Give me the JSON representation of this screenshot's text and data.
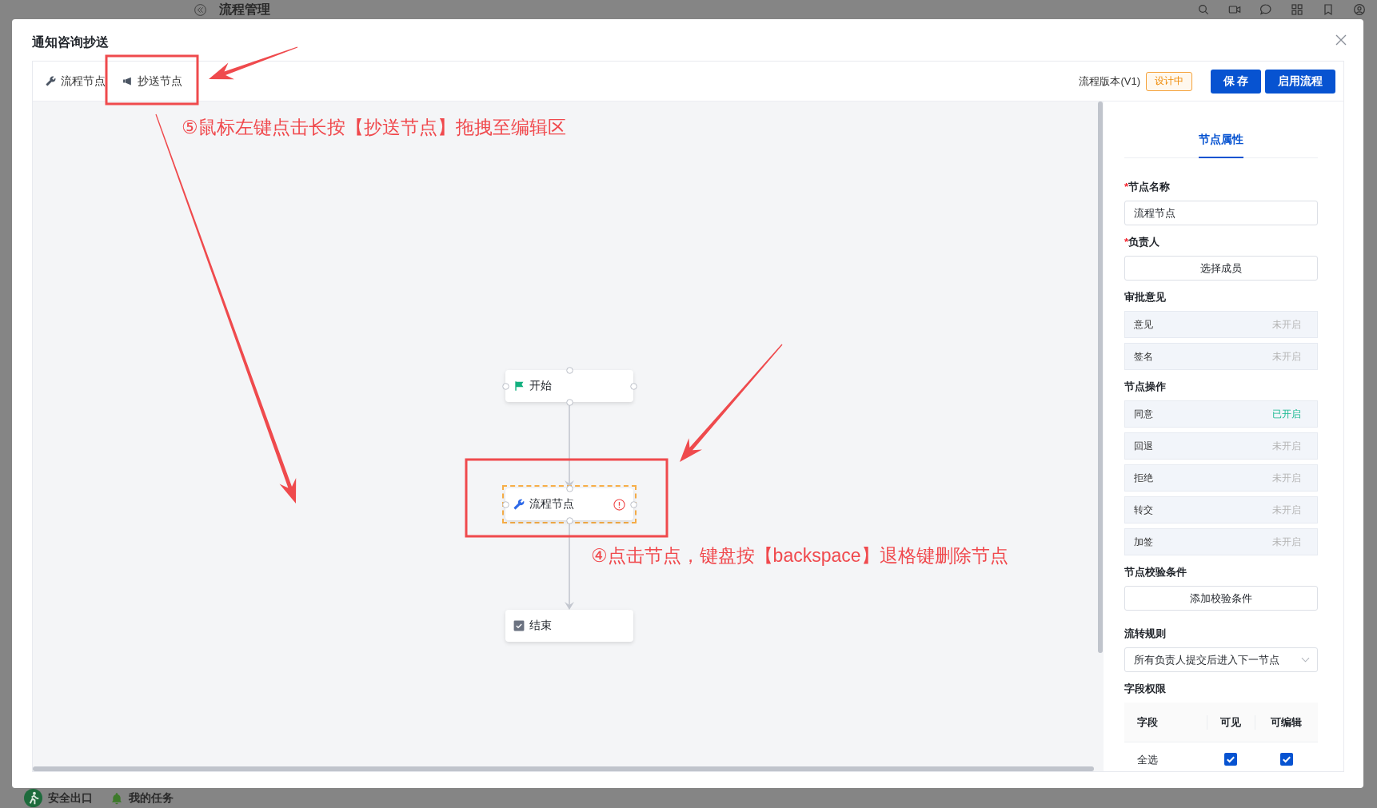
{
  "background": {
    "header_title": "流程管理",
    "footer_items": [
      {
        "kind": "exit",
        "label": "安全出口"
      },
      {
        "kind": "tasks",
        "label": "我的任务"
      }
    ]
  },
  "dialog": {
    "title": "通知咨询抄送"
  },
  "toolbar": {
    "palette": [
      {
        "kind": "task",
        "label": "流程节点"
      },
      {
        "kind": "cc",
        "label": "抄送节点"
      }
    ],
    "version": "流程版本(V1)",
    "status_badge": "设计中",
    "buttons": [
      "保 存",
      "启用流程"
    ]
  },
  "canvas": {
    "nodes": [
      {
        "kind": "start",
        "label": "开始",
        "selected": false,
        "warning": false
      },
      {
        "kind": "task",
        "label": "流程节点",
        "selected": true,
        "warning": true
      },
      {
        "kind": "end",
        "label": "结束",
        "selected": false,
        "warning": false
      }
    ]
  },
  "panel": {
    "tabs": [
      {
        "label": "节点属性",
        "selected": true
      }
    ],
    "sections": [
      {
        "kind": "input",
        "required_mark": "*",
        "label": "节点名称",
        "value": "流程节点"
      },
      {
        "kind": "button",
        "required_mark": "*",
        "label": "负责人",
        "button": "选择成员"
      },
      {
        "kind": "toggles",
        "label": "审批意见",
        "items": [
          {
            "label": "意见",
            "status": "未开启",
            "on": false
          },
          {
            "label": "签名",
            "status": "未开启",
            "on": false
          }
        ]
      },
      {
        "kind": "toggles",
        "label": "节点操作",
        "items": [
          {
            "label": "同意",
            "status": "已开启",
            "on": true
          },
          {
            "label": "回退",
            "status": "未开启",
            "on": false
          },
          {
            "label": "拒绝",
            "status": "未开启",
            "on": false
          },
          {
            "label": "转交",
            "status": "未开启",
            "on": false
          },
          {
            "label": "加签",
            "status": "未开启",
            "on": false
          }
        ]
      },
      {
        "kind": "button",
        "label": "节点校验条件",
        "button": "添加校验条件"
      },
      {
        "kind": "select",
        "label": "流转规则",
        "value": "所有负责人提交后进入下一节点"
      },
      {
        "kind": "table",
        "label": "字段权限",
        "columns": [
          "字段",
          "可见",
          "可编辑"
        ],
        "rows": [
          {
            "field": "全选",
            "visible": true,
            "editable": true
          }
        ]
      }
    ]
  },
  "annotations": [
    {
      "text": "⑤鼠标左键点击长按【抄送节点】拖拽至编辑区"
    },
    {
      "text": "④点击节点，键盘按【backspace】退格键删除节点"
    }
  ]
}
